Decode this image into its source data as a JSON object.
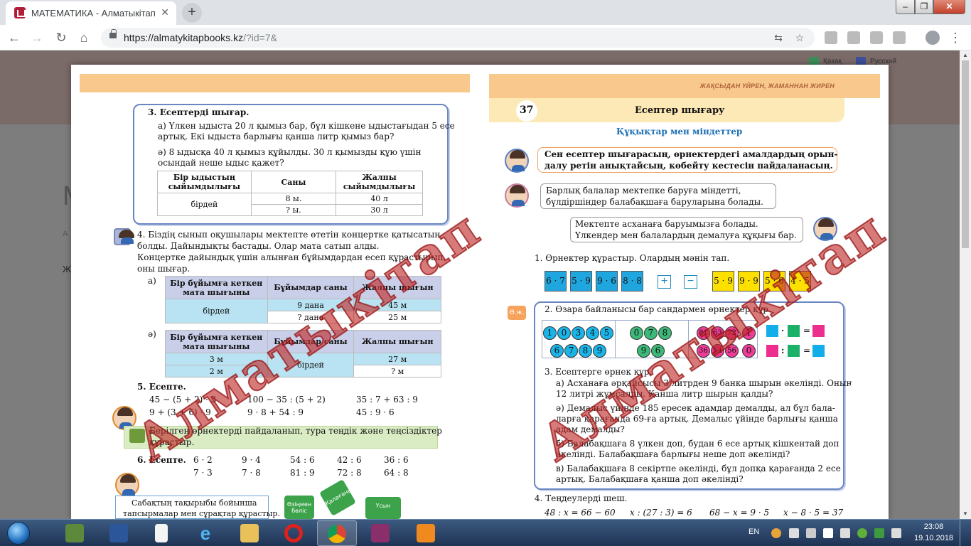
{
  "browser": {
    "tab_title": "МАТЕМАТИКА - Алматыкітап",
    "url_host": "https://almatykitapbooks.kz",
    "url_rest": "/?id=7&",
    "new_tab": "+",
    "close_tab": "✕"
  },
  "site": {
    "lang_kz": "Қазақ",
    "lang_ru": "Русский",
    "bg_letter_1": "М",
    "bg_letter_2": "А",
    "bg_letter_3": "Ж"
  },
  "left_page": {
    "task3_title": "3. Есептерді шығар.",
    "task3a_l1": "а) Үлкен ыдыста 20 л қымыз бар, бұл кішкене ыдыстағыдан 5 есе",
    "task3a_l2": "артық. Екі ыдыста барлығы қанша литр қымыз бар?",
    "task3b_l1": "ә) 8 ыдысқа 40 л қымыз құйылды. 30 л қымызды құю үшін",
    "task3b_l2": "осындай неше ыдыс қажет?",
    "t1_h1": "Бір ыдыстың сыйымдылығы",
    "t1_h2": "Саны",
    "t1_h3": "Жалпы сыйымдылығы",
    "t1_r1c1": "бірдей",
    "t1_r1c2": "8 ы.",
    "t1_r1c3": "40 л",
    "t1_r2c2": "? ы.",
    "t1_r2c3": "30 л",
    "task4_l1": "4. Біздің сынып оқушылары мектепте өтетін концертке қатысатын",
    "task4_l2": "болды. Дайындықты бастады. Олар мата сатып алды.",
    "task4_l3": "Концертке дайындық үшін алынған бұйымдардан есеп құрастырып,",
    "task4_l4": "оны шығар.",
    "label_a": "а)",
    "label_b": "ә)",
    "t2_h1": "Бір бұйымға кеткен мата шығыны",
    "t2_h2": "Бұйымдар саны",
    "t2_h3": "Жалпы шығын",
    "t2_r1c1": "бірдей",
    "t2_r1c2": "9 дана",
    "t2_r1c3": "45 м",
    "t2_r2c2": "? дана",
    "t2_r2c3": "25 м",
    "t3_r1c1": "3 м",
    "t3_r1c2": "бірдей",
    "t3_r1c3": "27 м",
    "t3_r2c1": "2 м",
    "t3_r2c3": "? м",
    "task5_title": "5. Есепте.",
    "e5_1": "45 − (5 + 2) · 3",
    "e5_2": "100 − 35 : (5 + 2)",
    "e5_3": "35 : 7 + 63 : 9",
    "e5_4": "9 + (3 + 6) · 9",
    "e5_5": "9 · 8 + 54 : 9",
    "e5_6": "45 : 9 · 6",
    "green_l1": "Берілген өрнектерді пайдаланып, тура теңдік және теңсіздіктер",
    "green_l2": "құрастыр.",
    "task6_title": "6. Есепте.",
    "e6": [
      "6 · 2",
      "9 · 4",
      "54 : 6",
      "42 : 6",
      "36 : 6",
      "7 · 3",
      "7 · 8",
      "81 : 9",
      "72 : 8",
      "64 : 8"
    ],
    "bottom_l1": "Сабақтың тақырыбы бойынша",
    "bottom_l2": "тапсырмалар мен сұрақтар құрастыр.",
    "puzzle_1": "Өзіңмен бөліс",
    "puzzle_2": "Қалағаныңды",
    "puzzle_3": "Үсын"
  },
  "right_page": {
    "strip_caption": "ЖАҚСЫДАН ҮЙРЕН, ЖАМАННАН ЖИРЕН",
    "lesson_number": "37",
    "lesson_title": "Есептер шығару",
    "subtitle": "Құқықтар мен міндеттер",
    "speech1_l1": "Сен есептер шығарасың, өрнектердегі амалдардың орын-",
    "speech1_l2": "далу ретін анықтайсың, көбейту кестесін пайдаланасың.",
    "speech2_l1": "Барлық балалар мектепке баруға міндетті,",
    "speech2_l2": "бүлдіршіндер балабақшаға баруларына болады.",
    "speech3_l1": "Мектепте асханаға баруымызға болады.",
    "speech3_l2": "Үлкендер мен балалардың демалуға құқығы бар.",
    "task1": "1. Өрнектер құрастыр. Олардың мәнін тап.",
    "blue_tiles": [
      "6 · 7",
      "5 · 9",
      "9 · 6",
      "8 · 8"
    ],
    "plus": "+",
    "minus": "−",
    "yellow_tiles": [
      "5 · 9",
      "9 · 9",
      "5 · 6",
      "4 · 5"
    ],
    "oj": "Ө.ж.",
    "task2": "2. Өзара байланысы бар сандармен өрнектер құр.",
    "blue_nums_1": [
      "1",
      "0",
      "3",
      "4",
      "5"
    ],
    "blue_nums_2": [
      "6",
      "7",
      "8",
      "9"
    ],
    "green_nums_1": [
      "0",
      "7",
      "8"
    ],
    "green_nums_2": [
      "9",
      "6"
    ],
    "pink_nums_1": [
      "81",
      "63",
      "72",
      "1"
    ],
    "pink_nums_2": [
      "36",
      "54",
      "56",
      "0"
    ],
    "dot": "·",
    "colon": ":",
    "eq": "=",
    "task3_title": "3. Есептерге өрнек құр.",
    "t3a_l1": "а) Асханаға әрқайсысы 3 литрден 9 банка шырын әкелінді. Оның",
    "t3a_l2": "12 литрі жұмсалды. Қанша литр шырын қалды?",
    "t3b_l1": "ә) Демалыс үйінде 185 ересек адамдар демалды, ал бұл бала-",
    "t3b_l2": "ларға қарағанда 69-ға артық. Демалыс үйінде барлығы қанша",
    "t3b_l3": "адам демалды?",
    "t3c_l1": "б) Балабақшаға 8 үлкен доп, будан 6 есе артық кішкентай доп",
    "t3c_l2": "әкелінді. Балабақшаға барлығы неше доп әкелінді?",
    "t3d_l1": "в) Балабақшаға 8 секіртпе әкелінді, бұл допқа қарағанда 2 есе",
    "t3d_l2": "артық. Балабақшаға қанша доп әкелінді?",
    "task4": "4. Теңдеулерді шеш.",
    "eq1": "48 : x = 66 − 60",
    "eq2": "x : (27 : 3) = 6",
    "eq3": "68 − x = 9 · 5",
    "eq4": "x − 8 · 5 = 37"
  },
  "watermark": "Алматыкітап",
  "taskbar": {
    "lang": "EN",
    "time": "23:08",
    "date": "19.10.2018"
  },
  "colors": {
    "strip": "#f8c88c",
    "box_border": "#6a86c2",
    "watermark": "#be2828",
    "taskbar": "#2b4468"
  }
}
